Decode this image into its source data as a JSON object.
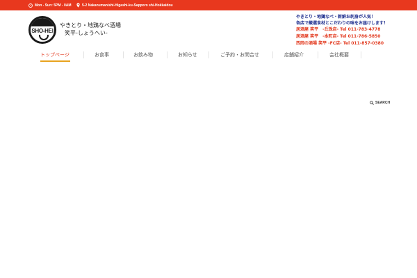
{
  "topbar": {
    "hours": "Mon - Sun: 5PM - 0AM",
    "address": "5-2 Nakanumanishi-Higashi-ku-Sapporo shi-Hokkaidou",
    "color": "#e8381e"
  },
  "logo": {
    "text": "SHO-HEI"
  },
  "header": {
    "title_line1": "やきとり・地鶏なべ酒場",
    "title_line2": "笑平-しょうへい-"
  },
  "promo": {
    "line1": "やきとり・地鶏なべ・新鮮お刺身が人気！",
    "line2": "各店で厳選食材とこだわりの味をお届けします！"
  },
  "shops": [
    {
      "label": "居酒屋 笑平　-丘珠店-  Tel 011-783-4778"
    },
    {
      "label": "居酒屋 笑平　-本町店-  Tel 011-786-5850"
    },
    {
      "label": "西岡の酒場 笑平 -FC店-  Tel 011-857-0380"
    }
  ],
  "nav": {
    "items": [
      {
        "label": "トップページ"
      },
      {
        "label": "お食事"
      },
      {
        "label": "お飲み物"
      },
      {
        "label": "お知らせ"
      },
      {
        "label": "ご予約・お問合せ"
      },
      {
        "label": "店舗紹介"
      },
      {
        "label": "会社概要"
      }
    ],
    "search_label": "SEARCH",
    "active_color": "#e23a1f",
    "underline_color": "#e8a21e"
  }
}
